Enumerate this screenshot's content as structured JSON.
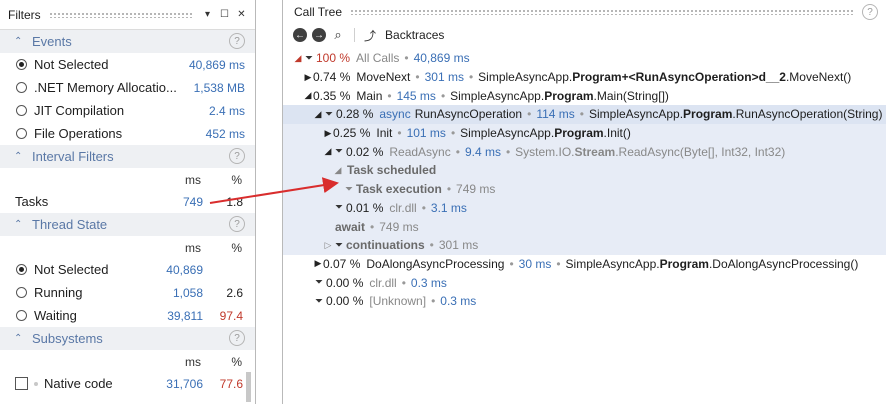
{
  "filters": {
    "title": "Filters",
    "events": {
      "title": "Events",
      "items": [
        {
          "label": "Not Selected",
          "value": "40,869 ms",
          "selected": true
        },
        {
          "label": ".NET Memory Allocatio...",
          "value": "1,538 MB"
        },
        {
          "label": "JIT Compilation",
          "value": "2.4 ms"
        },
        {
          "label": "File Operations",
          "value": "452 ms"
        }
      ]
    },
    "interval": {
      "title": "Interval Filters",
      "col_ms": "ms",
      "col_pct": "%",
      "tasks_label": "Tasks",
      "tasks_ms": "749",
      "tasks_pct": "1.8"
    },
    "thread": {
      "title": "Thread State",
      "col_ms": "ms",
      "col_pct": "%",
      "items": [
        {
          "label": "Not Selected",
          "ms": "40,869",
          "pct": ""
        },
        {
          "label": "Running",
          "ms": "1,058",
          "pct": "2.6"
        },
        {
          "label": "Waiting",
          "ms": "39,811",
          "pct": "97.4"
        }
      ]
    },
    "subsystems": {
      "title": "Subsystems",
      "col_ms": "ms",
      "col_pct": "%",
      "native_label": "Native code",
      "native_ms": "31,706",
      "native_pct": "77.6"
    }
  },
  "calltree": {
    "title": "Call Tree",
    "backtraces_label": "Backtraces",
    "rows": {
      "r0": {
        "pct": "100 %",
        "name": "All Calls",
        "time": "40,869 ms"
      },
      "r1": {
        "pct": "0.74 %",
        "name": "MoveNext",
        "time": "301 ms",
        "m1": "SimpleAsyncApp.",
        "m2": "Program",
        "m3": "+<RunAsyncOperation>d__2",
        "m4": ".MoveNext()"
      },
      "r2": {
        "pct": "0.35 %",
        "name": "Main",
        "time": "145 ms",
        "m1": "SimpleAsyncApp.",
        "m2": "Program",
        "m3": ".Main(String[])"
      },
      "r3": {
        "pct": "0.28 %",
        "kw": "async",
        "name": "RunAsyncOperation",
        "time": "114 ms",
        "m1": "SimpleAsyncApp.",
        "m2": "Program",
        "m3": ".RunAsyncOperation(String)"
      },
      "r4": {
        "pct": "0.25 %",
        "name": "Init",
        "time": "101 ms",
        "m1": "SimpleAsyncApp.",
        "m2": "Program",
        "m3": ".Init()"
      },
      "r5": {
        "pct": "0.02 %",
        "name": "ReadAsync",
        "time": "9.4 ms",
        "m1": "System.IO.",
        "m2": "Stream",
        "m3": ".ReadAsync(Byte[], Int32, Int32)"
      },
      "r6": {
        "name": "Task scheduled"
      },
      "r7": {
        "name": "Task execution",
        "time": "749 ms"
      },
      "r8": {
        "pct": "0.01 %",
        "name": "clr.dll",
        "time": "3.1 ms"
      },
      "r9": {
        "name": "await",
        "time": "749 ms"
      },
      "r10": {
        "name": "continuations",
        "time": "301 ms"
      },
      "r11": {
        "pct": "0.07 %",
        "name": "DoAlongAsyncProcessing",
        "time": "30 ms",
        "m1": "SimpleAsyncApp.",
        "m2": "Program",
        "m3": ".DoAlongAsyncProcessing()"
      },
      "r12": {
        "pct": "0.00 %",
        "name": "clr.dll",
        "time": "0.3 ms"
      },
      "r13": {
        "pct": "0.00 %",
        "name": "[Unknown]",
        "time": "0.3 ms"
      }
    }
  },
  "colors": {
    "accent": "#3a6fb5",
    "hot": "#c0392b",
    "arrow": "#d92d2d",
    "highlight": "#dce4f2"
  }
}
